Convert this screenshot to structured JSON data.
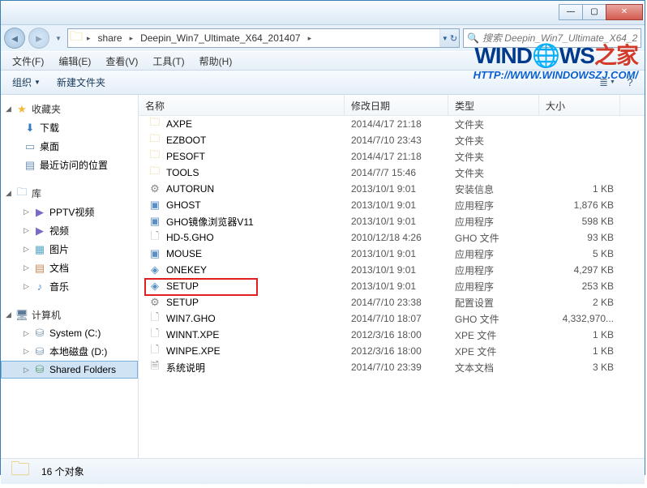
{
  "window": {
    "minimize": "—",
    "maximize": "▢",
    "close": "✕"
  },
  "nav": {
    "back": "◄",
    "forward": "►",
    "dropdown": "▼",
    "refresh": "↻"
  },
  "address": {
    "seg1": "share",
    "seg2": "Deepin_Win7_Ultimate_X64_201407",
    "arrow": "▸"
  },
  "search": {
    "icon": "🔍",
    "placeholder": "搜索 Deepin_Win7_Ultimate_X64_2..."
  },
  "menubar": {
    "file": "文件(F)",
    "edit": "编辑(E)",
    "view": "查看(V)",
    "tools": "工具(T)",
    "help": "帮助(H)"
  },
  "toolbar": {
    "organize": "组织",
    "newfolder": "新建文件夹",
    "drop": "▼",
    "views": "≣",
    "help": "?"
  },
  "sidebar": {
    "exp_open": "◢",
    "exp_closed": "▷",
    "favorites": {
      "label": "收藏夹",
      "icon": "★"
    },
    "downloads": {
      "label": "下载",
      "icon": "⬇"
    },
    "desktop": {
      "label": "桌面",
      "icon": "▭"
    },
    "recent": {
      "label": "最近访问的位置",
      "icon": "▤"
    },
    "libraries": {
      "label": "库",
      "icon": "🗀"
    },
    "pptv": {
      "label": "PPTV视频",
      "icon": "▶"
    },
    "videos": {
      "label": "视频",
      "icon": "▶"
    },
    "pictures": {
      "label": "图片",
      "icon": "▦"
    },
    "documents": {
      "label": "文档",
      "icon": "▤"
    },
    "music": {
      "label": "音乐",
      "icon": "♪"
    },
    "computer": {
      "label": "计算机",
      "icon": "🖥"
    },
    "cdrive": {
      "label": "System (C:)",
      "icon": "⛁"
    },
    "ddrive": {
      "label": "本地磁盘 (D:)",
      "icon": "⛁"
    },
    "shared": {
      "label": "Shared Folders",
      "icon": "⛁"
    }
  },
  "columns": {
    "name": "名称",
    "date": "修改日期",
    "type": "类型",
    "size": "大小"
  },
  "files": [
    {
      "icon": "🗀",
      "iconClass": "ic-folder",
      "name": "AXPE",
      "date": "2014/4/17 21:18",
      "type": "文件夹",
      "size": ""
    },
    {
      "icon": "🗀",
      "iconClass": "ic-folder",
      "name": "EZBOOT",
      "date": "2014/7/10 23:43",
      "type": "文件夹",
      "size": ""
    },
    {
      "icon": "🗀",
      "iconClass": "ic-folder",
      "name": "PESOFT",
      "date": "2014/4/17 21:18",
      "type": "文件夹",
      "size": ""
    },
    {
      "icon": "🗀",
      "iconClass": "ic-folder",
      "name": "TOOLS",
      "date": "2014/7/7 15:46",
      "type": "文件夹",
      "size": ""
    },
    {
      "icon": "⚙",
      "iconClass": "ic-ini",
      "name": "AUTORUN",
      "date": "2013/10/1 9:01",
      "type": "安装信息",
      "size": "1 KB"
    },
    {
      "icon": "▣",
      "iconClass": "ic-exe",
      "name": "GHOST",
      "date": "2013/10/1 9:01",
      "type": "应用程序",
      "size": "1,876 KB"
    },
    {
      "icon": "▣",
      "iconClass": "ic-exe",
      "name": "GHO镜像浏览器V11",
      "date": "2013/10/1 9:01",
      "type": "应用程序",
      "size": "598 KB"
    },
    {
      "icon": "🗋",
      "iconClass": "ic-gho",
      "name": "HD-5.GHO",
      "date": "2010/12/18 4:26",
      "type": "GHO 文件",
      "size": "93 KB"
    },
    {
      "icon": "▣",
      "iconClass": "ic-exe",
      "name": "MOUSE",
      "date": "2013/10/1 9:01",
      "type": "应用程序",
      "size": "5 KB"
    },
    {
      "icon": "◈",
      "iconClass": "ic-setup",
      "name": "ONEKEY",
      "date": "2013/10/1 9:01",
      "type": "应用程序",
      "size": "4,297 KB"
    },
    {
      "icon": "◈",
      "iconClass": "ic-setup",
      "name": "SETUP",
      "date": "2013/10/1 9:01",
      "type": "应用程序",
      "size": "253 KB"
    },
    {
      "icon": "⚙",
      "iconClass": "ic-ini",
      "name": "SETUP",
      "date": "2014/7/10 23:38",
      "type": "配置设置",
      "size": "2 KB"
    },
    {
      "icon": "🗋",
      "iconClass": "ic-gho",
      "name": "WIN7.GHO",
      "date": "2014/7/10 18:07",
      "type": "GHO 文件",
      "size": "4,332,970..."
    },
    {
      "icon": "🗋",
      "iconClass": "ic-gho",
      "name": "WINNT.XPE",
      "date": "2012/3/16 18:00",
      "type": "XPE 文件",
      "size": "1 KB"
    },
    {
      "icon": "🗋",
      "iconClass": "ic-gho",
      "name": "WINPE.XPE",
      "date": "2012/3/16 18:00",
      "type": "XPE 文件",
      "size": "1 KB"
    },
    {
      "icon": "🗎",
      "iconClass": "ic-txt",
      "name": "系统说明",
      "date": "2014/7/10 23:39",
      "type": "文本文档",
      "size": "3 KB"
    }
  ],
  "status": {
    "icon": "🗀",
    "text": "16 个对象"
  },
  "watermark": {
    "w": "WIND",
    "o": "🌐",
    "ws": "WS",
    "zhijia": "之家",
    "url": "HTTP://WWW.WINDOWSZJ.COM/"
  }
}
